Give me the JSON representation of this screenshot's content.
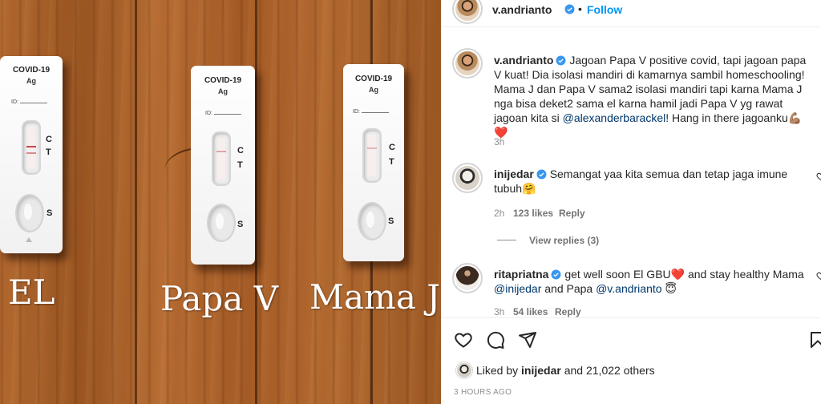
{
  "photo": {
    "tests": [
      {
        "title": "COVID-19",
        "subtitle": "Ag",
        "id_label": "ID:",
        "c_label": "C",
        "t_label": "T",
        "s_label": "S"
      },
      {
        "title": "COVID-19",
        "subtitle": "Ag",
        "id_label": "ID:",
        "c_label": "C",
        "t_label": "T",
        "s_label": "S"
      },
      {
        "title": "COVID-19",
        "subtitle": "Ag",
        "id_label": "ID:",
        "c_label": "C",
        "t_label": "T",
        "s_label": "S"
      }
    ],
    "captions": [
      "EL",
      "Papa V",
      "Mama J"
    ]
  },
  "header": {
    "username": "v.andrianto",
    "separator": "•",
    "follow_label": "Follow"
  },
  "caption": {
    "username": "v.andrianto",
    "text": "Jagoan Papa V positive covid, tapi jagoan papa V kuat! Dia isolasi mandiri di kamarnya sambil homeschooling! Mama J dan Papa V sama2 isolasi mandiri tapi karna Mama J nga bisa deket2 sama el karna hamil jadi Papa V yg rawat jagoan kita si ",
    "mention": "@alexanderbarackel",
    "text_end": "! Hang in there jagoanku💪🏽 ❤️",
    "time": "3h"
  },
  "comments": [
    {
      "username": "inijedar",
      "text": "Semangat yaa kita semua dan tetap jaga imune tubuh🤗",
      "time": "2h",
      "likes": "123 likes",
      "reply_label": "Reply",
      "view_replies": "View replies (3)"
    },
    {
      "username": "ritapriatna",
      "text_start": "get well soon El GBU❤️  and stay healthy Mama ",
      "mention1": "@inijedar",
      "text_mid": " and Papa ",
      "mention2": "@v.andrianto",
      "text_end": " 😇",
      "time": "3h",
      "likes": "54 likes",
      "reply_label": "Reply"
    }
  ],
  "actions": {
    "like_icon": "heart-icon",
    "comment_icon": "comment-icon",
    "share_icon": "share-icon",
    "save_icon": "bookmark-icon"
  },
  "liked_by": {
    "prefix": "Liked by ",
    "user": "inijedar",
    "middle": " and ",
    "count": "21,022 others"
  },
  "timestamp": "3 HOURS AGO",
  "colors": {
    "accent": "#0095f6",
    "verified": "#3897f0",
    "heart": "#ed4956",
    "link": "#00376b",
    "muted": "#8e8e8e"
  }
}
